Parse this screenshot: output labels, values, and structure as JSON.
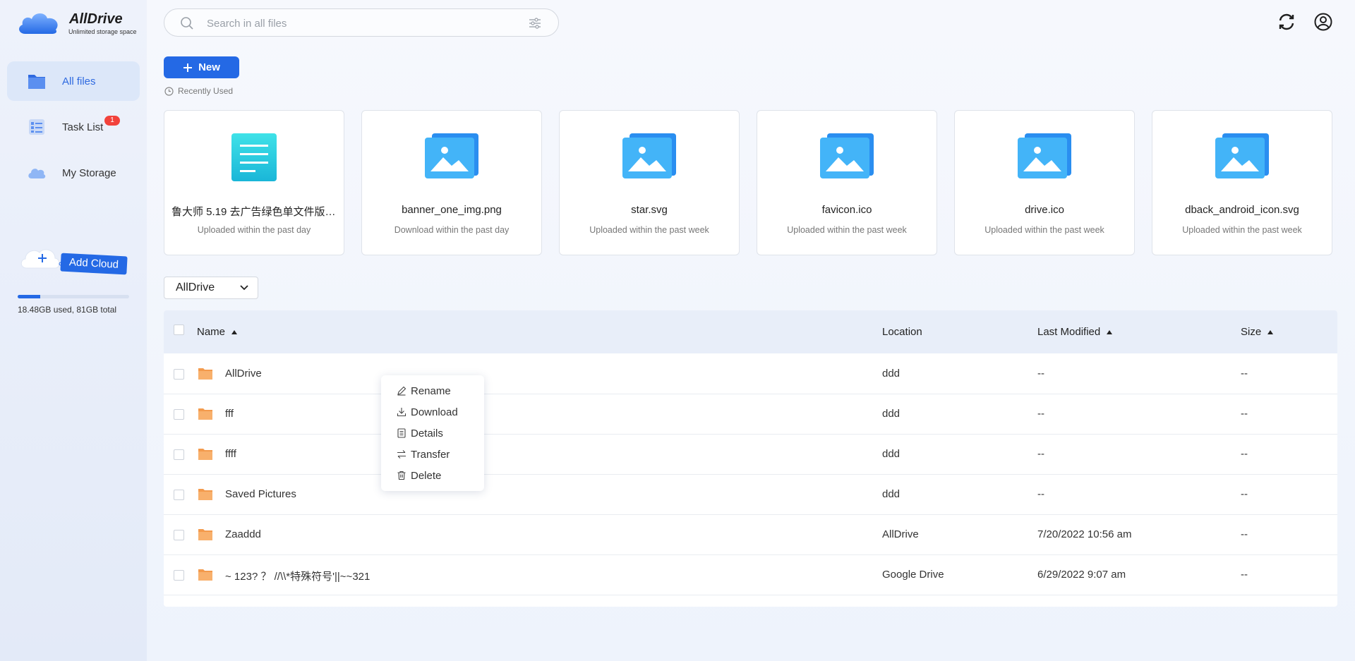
{
  "app": {
    "name": "AllDrive",
    "tagline": "Unlimited storage space",
    "accent_color": "#2469e5",
    "badge_color": "#f2423b"
  },
  "sidebar": {
    "items": [
      {
        "label": "All files",
        "icon": "folder-icon",
        "active": true
      },
      {
        "label": "Task List",
        "icon": "task-list-icon",
        "badge": "1"
      },
      {
        "label": "My Storage",
        "icon": "cloud-icon"
      }
    ],
    "add_cloud_label": "Add Cloud",
    "storage": {
      "text": "18.48GB used, 81GB total",
      "fraction_used": 0.2
    }
  },
  "search": {
    "placeholder": "Search in all files",
    "value": ""
  },
  "toolbar": {
    "new_label": "New"
  },
  "recent": {
    "label": "Recently Used",
    "files": [
      {
        "name": "鲁大师 5.19 去广告绿色单文件版....",
        "when": "Uploaded within the past day",
        "icon": "document-icon"
      },
      {
        "name": "banner_one_img.png",
        "when": "Download within the past day",
        "icon": "image-icon"
      },
      {
        "name": "star.svg",
        "when": "Uploaded within the past week",
        "icon": "image-icon"
      },
      {
        "name": "favicon.ico",
        "when": "Uploaded within the past week",
        "icon": "image-icon"
      },
      {
        "name": "drive.ico",
        "when": "Uploaded within the past week",
        "icon": "image-icon"
      },
      {
        "name": "dback_android_icon.svg",
        "when": "Uploaded within the past week",
        "icon": "image-icon"
      }
    ]
  },
  "drive_select": {
    "value": "AllDrive"
  },
  "table": {
    "headers": {
      "name": "Name",
      "location": "Location",
      "modified": "Last Modified",
      "size": "Size"
    },
    "rows": [
      {
        "name": "AllDrive",
        "location": "ddd",
        "modified": "--",
        "size": "--"
      },
      {
        "name": "fff",
        "location": "ddd",
        "modified": "--",
        "size": "--"
      },
      {
        "name": "ffff",
        "location": "ddd",
        "modified": "--",
        "size": "--"
      },
      {
        "name": "Saved Pictures",
        "location": "ddd",
        "modified": "--",
        "size": "--"
      },
      {
        "name": "Zaaddd",
        "location": "AllDrive",
        "modified": "7/20/2022 10:56 am",
        "size": "--"
      },
      {
        "name": "~ 123? ？ //\\\\*特殊符号'||~~321",
        "location": "Google Drive",
        "modified": "6/29/2022 9:07 am",
        "size": "--"
      }
    ]
  },
  "context_menu": {
    "items": [
      {
        "label": "Rename",
        "icon": "pencil-icon"
      },
      {
        "label": "Download",
        "icon": "download-icon"
      },
      {
        "label": "Details",
        "icon": "details-icon"
      },
      {
        "label": "Transfer",
        "icon": "transfer-icon"
      },
      {
        "label": "Delete",
        "icon": "trash-icon"
      }
    ]
  }
}
